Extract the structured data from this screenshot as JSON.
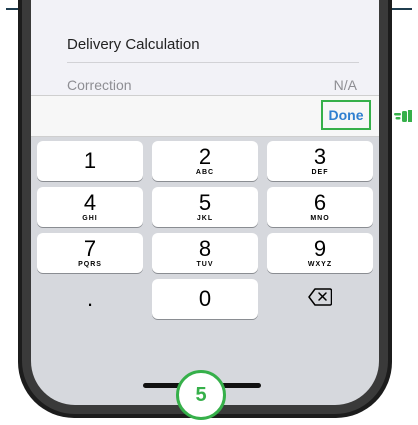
{
  "form": {
    "title": "Delivery Calculation",
    "correction_label": "Correction",
    "correction_value": "N/A"
  },
  "toolbar": {
    "done_label": "Done"
  },
  "keypad": {
    "keys": [
      {
        "num": "1",
        "letters": ""
      },
      {
        "num": "2",
        "letters": "ABC"
      },
      {
        "num": "3",
        "letters": "DEF"
      },
      {
        "num": "4",
        "letters": "GHI"
      },
      {
        "num": "5",
        "letters": "JKL"
      },
      {
        "num": "6",
        "letters": "MNO"
      },
      {
        "num": "7",
        "letters": "PQRS"
      },
      {
        "num": "8",
        "letters": "TUV"
      },
      {
        "num": "9",
        "letters": "WXYZ"
      },
      {
        "num": ".",
        "letters": ""
      },
      {
        "num": "0",
        "letters": ""
      }
    ],
    "delete_icon": "backspace-icon"
  },
  "step_badge": "5",
  "colors": {
    "accent_green": "#36b04a",
    "link_blue": "#2f7fd0"
  }
}
